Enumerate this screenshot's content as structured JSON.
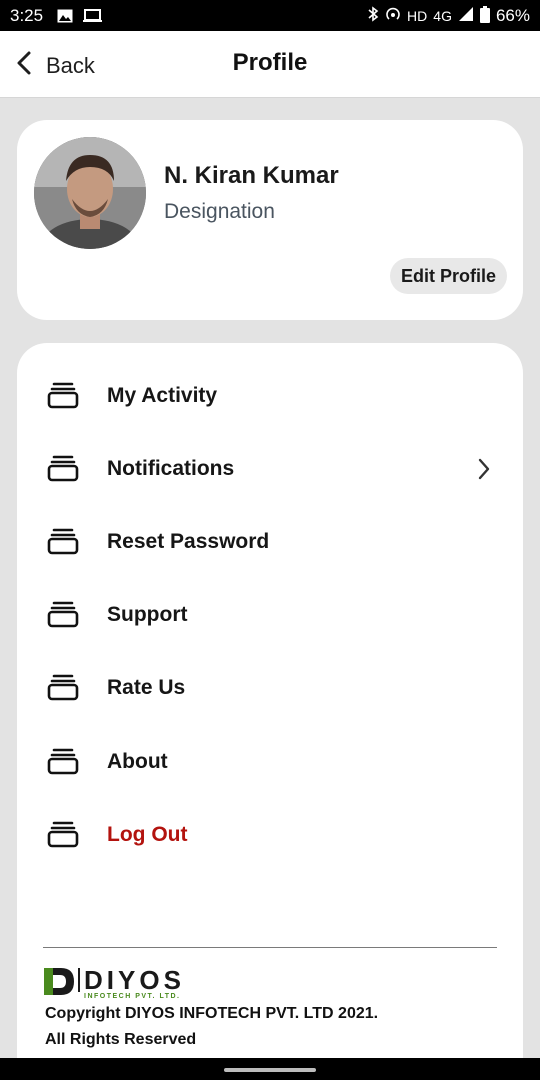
{
  "status_bar": {
    "time": "3:25",
    "network": "HD",
    "signal": "4G",
    "battery": "66%"
  },
  "header": {
    "back_label": "Back",
    "title": "Profile"
  },
  "profile": {
    "name": "N. Kiran Kumar",
    "designation": "Designation",
    "edit_label": "Edit Profile"
  },
  "menu": {
    "items": [
      {
        "label": "My Activity",
        "icon": "stack-icon"
      },
      {
        "label": "Notifications",
        "icon": "stack-icon",
        "chevron": true
      },
      {
        "label": "Reset Password",
        "icon": "stack-icon"
      },
      {
        "label": "Support",
        "icon": "stack-icon"
      },
      {
        "label": "Rate Us",
        "icon": "stack-icon"
      },
      {
        "label": "About",
        "icon": "stack-icon"
      },
      {
        "label": "Log Out",
        "icon": "stack-icon",
        "color": "#b3130e"
      }
    ]
  },
  "footer": {
    "logo_main": "DIYOS",
    "logo_sub": "INFOTECH PVT. LTD.",
    "copyright_line1": "Copyright DIYOS INFOTECH PVT. LTD 2021.",
    "copyright_line2": "All Rights Reserved"
  },
  "colors": {
    "background": "#e3e3e3",
    "card": "#ffffff",
    "logout": "#b3130e",
    "logo_green": "#4a8a1e"
  }
}
